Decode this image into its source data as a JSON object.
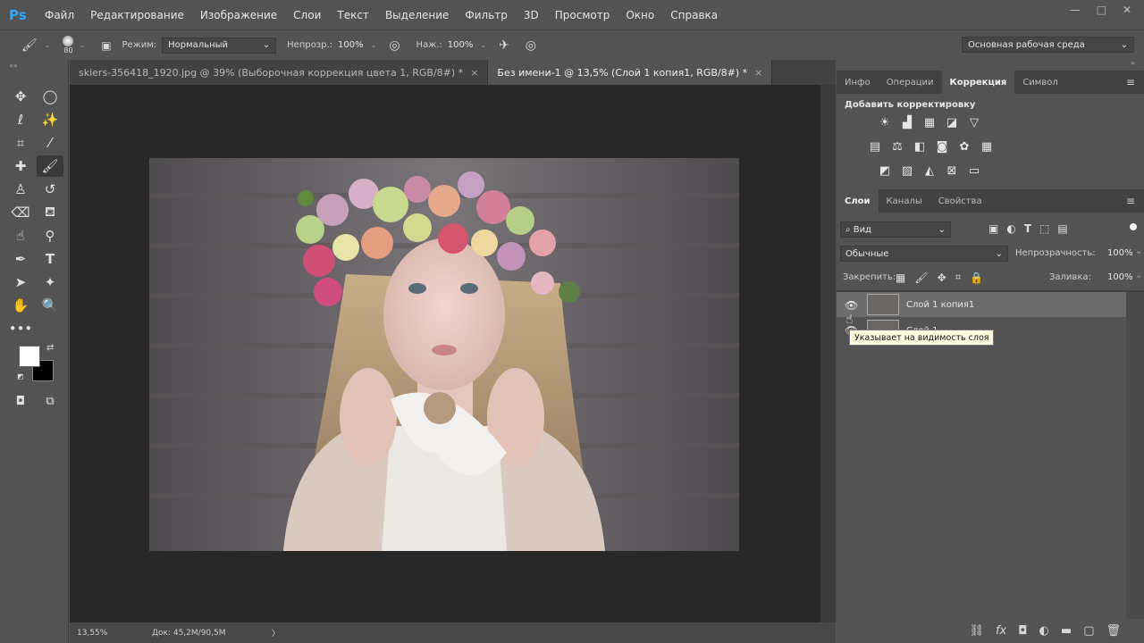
{
  "app": {
    "logo": "Ps"
  },
  "menu": [
    "Файл",
    "Редактирование",
    "Изображение",
    "Слои",
    "Текст",
    "Выделение",
    "Фильтр",
    "3D",
    "Просмотр",
    "Окно",
    "Справка"
  ],
  "window_controls": {
    "minimize": "—",
    "maximize": "□",
    "close": "✕"
  },
  "options_bar": {
    "brush_size": "80",
    "mode_label": "Режим:",
    "mode_value": "Нормальный",
    "opacity_label": "Непрозр.:",
    "opacity_value": "100%",
    "flow_label": "Наж.:",
    "flow_value": "100%",
    "workspace": "Основная рабочая среда"
  },
  "tabs": [
    {
      "label": "skiers-356418_1920.jpg @ 39% (Выборочная коррекция цвета 1, RGB/8#) *",
      "close": "×"
    },
    {
      "label": "Без имени-1 @ 13,5% (Слой 1 копия1, RGB/8#) *",
      "close": "×"
    }
  ],
  "status": {
    "zoom": "13,55%",
    "doc": "Док: 45,2M/90,5M",
    "arrow": "〉"
  },
  "panels": {
    "top_tabs": [
      "Инфо",
      "Операции",
      "Коррекция",
      "Символ"
    ],
    "add_adjustment": "Добавить корректировку",
    "layer_tabs": [
      "Слои",
      "Каналы",
      "Свойства"
    ],
    "filter_kind": "Вид",
    "blend_mode": "Обычные",
    "opacity_label": "Непрозрачность:",
    "opacity_value": "100%",
    "lock_label": "Закрепить:",
    "fill_label": "Заливка:",
    "fill_value": "100%",
    "layers": [
      {
        "name": "Слой 1 копия1"
      },
      {
        "name": "Слой 1"
      }
    ],
    "tooltip": "Указывает на видимость слоя"
  },
  "colors": {
    "accent_blue": "#31a8ff",
    "panel_bg": "#535353",
    "canvas_bg": "#282828"
  }
}
